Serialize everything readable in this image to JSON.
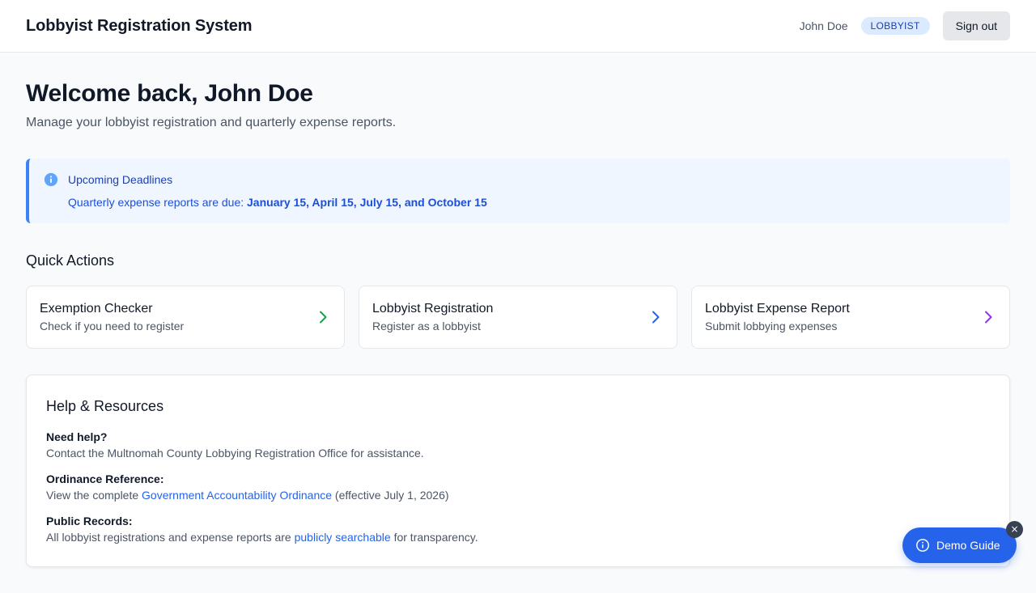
{
  "header": {
    "title": "Lobbyist Registration System",
    "user_name": "John Doe",
    "role": "LOBBYIST",
    "signout_label": "Sign out"
  },
  "welcome": {
    "heading": "Welcome back, John Doe",
    "subtitle": "Manage your lobbyist registration and quarterly expense reports."
  },
  "deadlines": {
    "title": "Upcoming Deadlines",
    "text": "Quarterly expense reports are due: ",
    "dates": "January 15, April 15, July 15, and October 15",
    "icon": "info-icon",
    "accent": "#3b82f6"
  },
  "quick_actions": {
    "title": "Quick Actions",
    "items": [
      {
        "title": "Exemption Checker",
        "description": "Check if you need to register",
        "icon": "chevron-right-icon",
        "color": "#16a34a"
      },
      {
        "title": "Lobbyist Registration",
        "description": "Register as a lobbyist",
        "icon": "chevron-right-icon",
        "color": "#2563eb"
      },
      {
        "title": "Lobbyist Expense Report",
        "description": "Submit lobbying expenses",
        "icon": "chevron-right-icon",
        "color": "#9333ea"
      }
    ]
  },
  "help": {
    "title": "Help & Resources",
    "need_help_label": "Need help?",
    "need_help_text": "Contact the Multnomah County Lobbying Registration Office for assistance.",
    "ordinance_label": "Ordinance Reference:",
    "ordinance_pre": "View the complete ",
    "ordinance_link": "Government Accountability Ordinance",
    "ordinance_post": " (effective July 1, 2026)",
    "records_label": "Public Records:",
    "records_pre": "All lobbyist registrations and expense reports are ",
    "records_link": "publicly searchable",
    "records_post": " for transparency."
  },
  "demo_guide": {
    "label": "Demo Guide",
    "close": "×",
    "icon": "info-circle-icon"
  }
}
